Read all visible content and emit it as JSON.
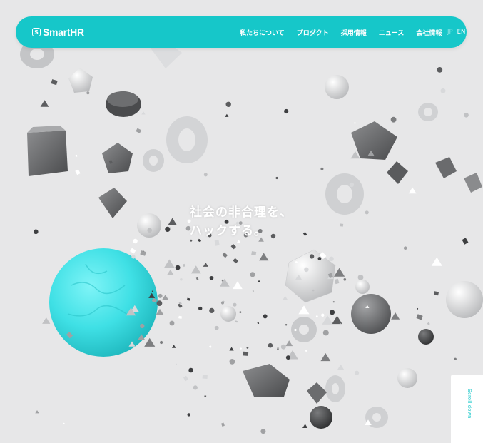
{
  "header": {
    "logo_glyph": "S",
    "logo_text": "SmartHR",
    "nav_items": [
      "私たちについて",
      "プロダクト",
      "採用情報",
      "ニュース",
      "会社情報"
    ],
    "lang": {
      "jp": "JP",
      "en": "EN",
      "current": "EN"
    }
  },
  "hero": {
    "tagline_line1": "社会の非合理を、",
    "tagline_line2": "ハックする。"
  },
  "scroll": {
    "label": "Scroll down"
  },
  "colors": {
    "accent": "#16c7c9",
    "background": "#e7e7e8",
    "sphere": "#3fe0e5"
  }
}
